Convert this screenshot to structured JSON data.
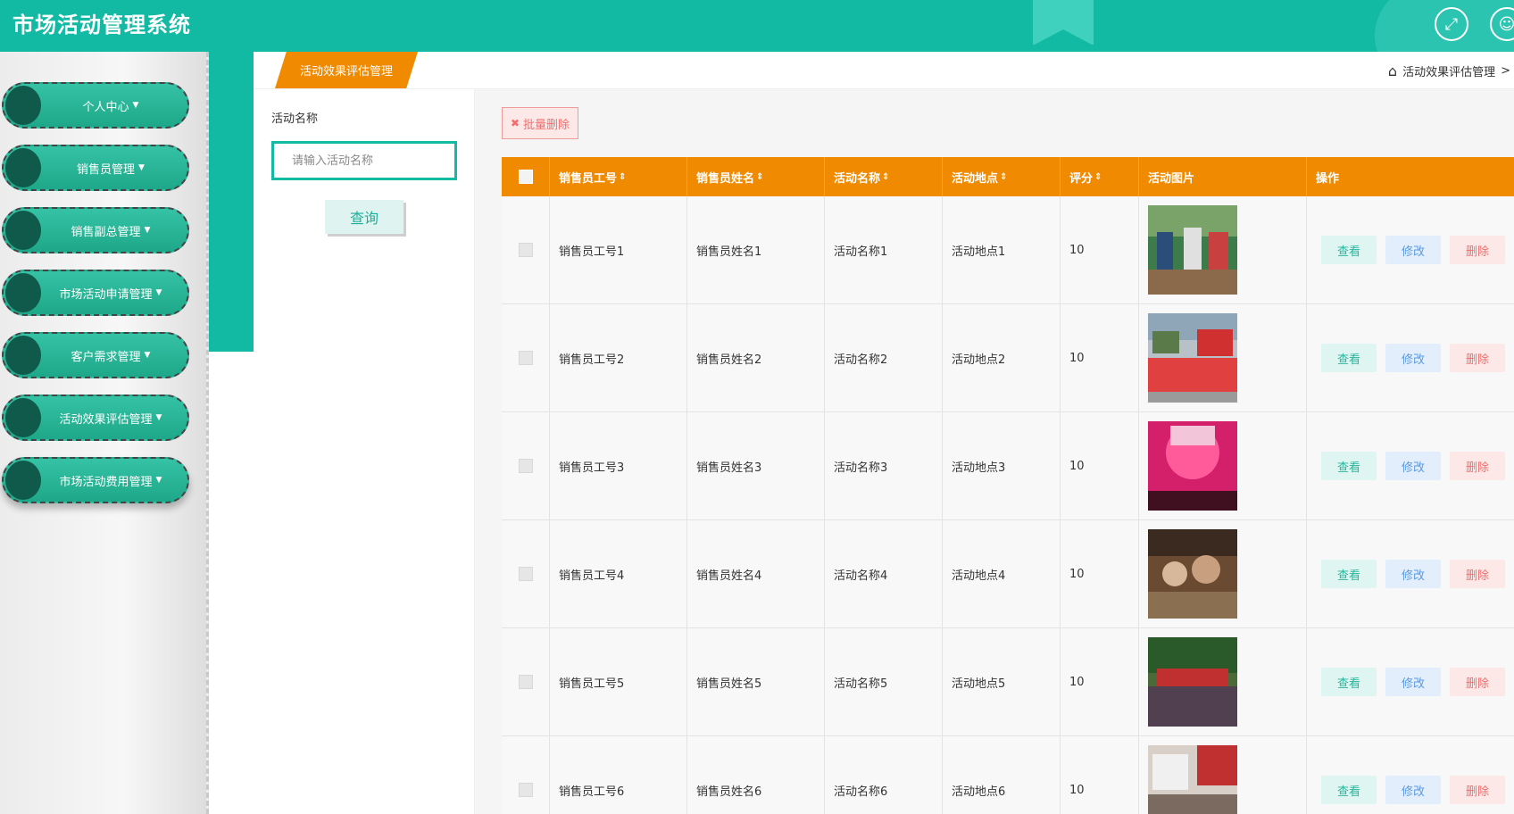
{
  "header": {
    "title": "市场活动管理系统"
  },
  "sidebar": {
    "items": [
      {
        "label": "个人中心"
      },
      {
        "label": "销售员管理"
      },
      {
        "label": "销售副总管理"
      },
      {
        "label": "市场活动申请管理"
      },
      {
        "label": "客户需求管理"
      },
      {
        "label": "活动效果评估管理"
      },
      {
        "label": "市场活动费用管理"
      }
    ]
  },
  "tabs": {
    "active": "活动效果评估管理"
  },
  "breadcrumb": {
    "text": "活动效果评估管理",
    "sep": ">"
  },
  "search": {
    "label": "活动名称",
    "placeholder": "请输入活动名称",
    "button": "查询"
  },
  "toolbar": {
    "batch_delete": "批量删除"
  },
  "table": {
    "headers": [
      "销售员工号",
      "销售员姓名",
      "活动名称",
      "活动地点",
      "评分",
      "活动图片",
      "操作"
    ],
    "actions": {
      "view": "查看",
      "edit": "修改",
      "delete": "删除"
    },
    "rows": [
      {
        "emp_id": "销售员工号1",
        "emp_name": "销售员姓名1",
        "activity": "活动名称1",
        "place": "活动地点1",
        "score": "10"
      },
      {
        "emp_id": "销售员工号2",
        "emp_name": "销售员姓名2",
        "activity": "活动名称2",
        "place": "活动地点2",
        "score": "10"
      },
      {
        "emp_id": "销售员工号3",
        "emp_name": "销售员姓名3",
        "activity": "活动名称3",
        "place": "活动地点3",
        "score": "10"
      },
      {
        "emp_id": "销售员工号4",
        "emp_name": "销售员姓名4",
        "activity": "活动名称4",
        "place": "活动地点4",
        "score": "10"
      },
      {
        "emp_id": "销售员工号5",
        "emp_name": "销售员姓名5",
        "activity": "活动名称5",
        "place": "活动地点5",
        "score": "10"
      },
      {
        "emp_id": "销售员工号6",
        "emp_name": "销售员姓名6",
        "activity": "活动名称6",
        "place": "活动地点6",
        "score": "10"
      }
    ]
  },
  "colors": {
    "primary": "#12b9a3",
    "accent": "#f08a00",
    "danger": "#f56c6c"
  },
  "icons": [
    "fullscreen-icon",
    "user-icon",
    "home-icon",
    "sort-icon",
    "close-icon"
  ]
}
